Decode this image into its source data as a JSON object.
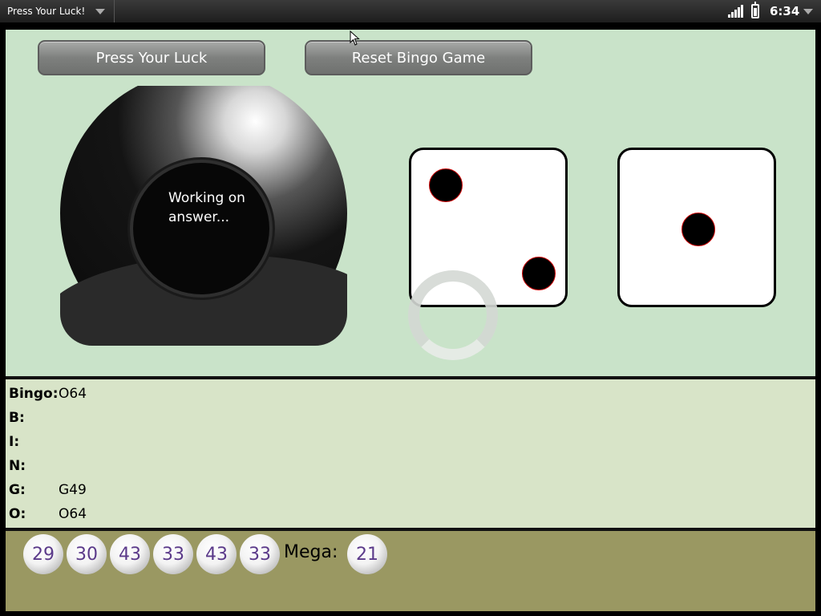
{
  "status_bar": {
    "app_title": "Press Your Luck!",
    "time": "6:34"
  },
  "buttons": {
    "press_luck": "Press Your Luck",
    "reset_bingo": "Reset Bingo Game"
  },
  "eight_ball": {
    "answer": "Working on answer..."
  },
  "dice": [
    {
      "value": 2
    },
    {
      "value": 1
    }
  ],
  "bingo": {
    "rows": [
      {
        "label": "Bingo:",
        "value": "O64"
      },
      {
        "label": "B:",
        "value": ""
      },
      {
        "label": "I:",
        "value": ""
      },
      {
        "label": "N:",
        "value": ""
      },
      {
        "label": "G:",
        "value": "G49"
      },
      {
        "label": "O:",
        "value": "O64"
      }
    ]
  },
  "lottery": {
    "numbers": [
      "29",
      "30",
      "43",
      "33",
      "43",
      "33"
    ],
    "mega_label": "Mega:",
    "mega_number": "21"
  },
  "colors": {
    "main_bg": "#c9e3c9",
    "bingo_bg": "#d8e4c8",
    "lotto_bg": "#9a9862",
    "ball_number": "#5b3a8a",
    "pip_outline": "#cc0000"
  }
}
